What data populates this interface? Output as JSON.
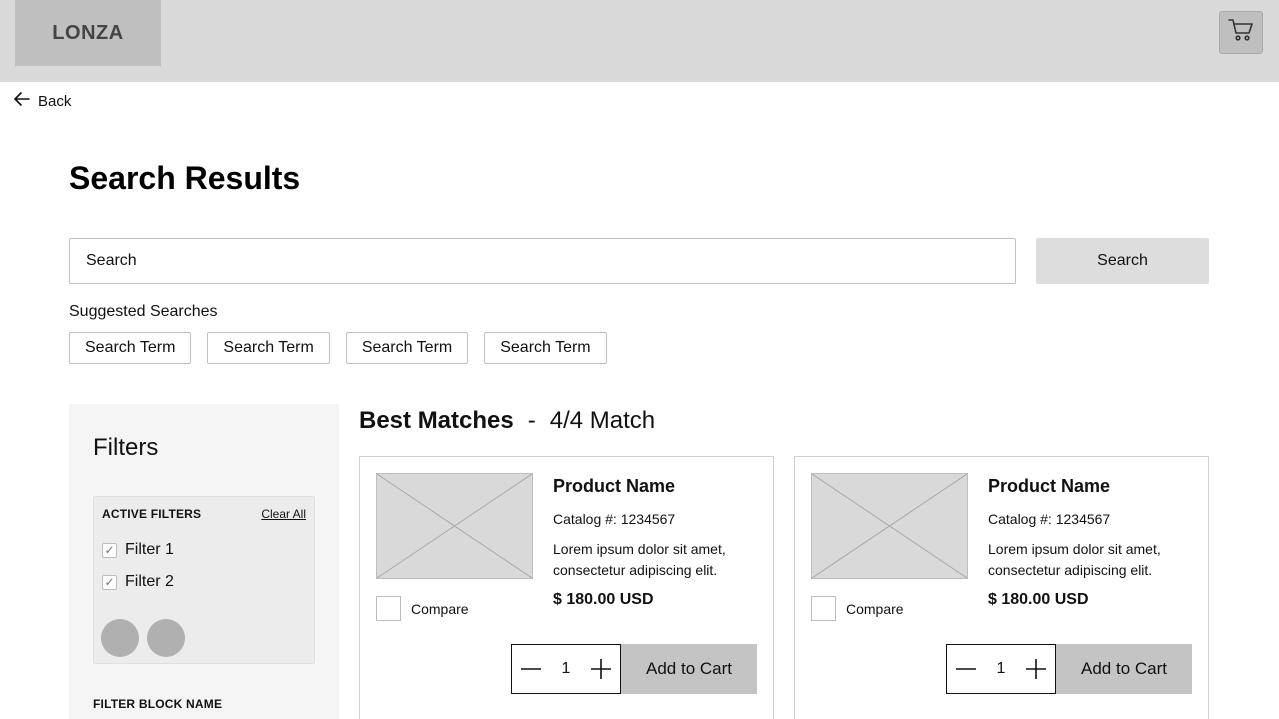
{
  "header": {
    "logo_text": "LONZA",
    "cart_icon": "cart-icon"
  },
  "nav": {
    "back_label": "Back",
    "back_icon": "arrow-left-icon"
  },
  "page": {
    "title": "Search Results"
  },
  "search": {
    "placeholder": "Search",
    "button_label": "Search"
  },
  "suggested": {
    "label": "Suggested Searches",
    "terms": [
      "Search Term",
      "Search Term",
      "Search Term",
      "Search Term"
    ]
  },
  "filters": {
    "title": "Filters",
    "active_label": "ACTIVE FILTERS",
    "clear_all_label": "Clear All",
    "active": [
      {
        "label": "Filter 1",
        "checked": true
      },
      {
        "label": "Filter 2",
        "checked": true
      }
    ],
    "block_name": "FILTER BLOCK NAME"
  },
  "results": {
    "heading": "Best Matches",
    "separator": "-",
    "match_text": "4/4 Match"
  },
  "products": [
    {
      "name": "Product Name",
      "catalog": "Catalog #: 1234567",
      "description": "Lorem ipsum dolor sit amet, consectetur adipiscing elit.",
      "price": "$ 180.00 USD",
      "compare_label": "Compare",
      "quantity": "1",
      "add_label": "Add to Cart"
    },
    {
      "name": "Product Name",
      "catalog": "Catalog #: 1234567",
      "description": "Lorem ipsum dolor sit amet, consectetur adipiscing elit.",
      "price": "$ 180.00 USD",
      "compare_label": "Compare",
      "quantity": "1",
      "add_label": "Add to Cart"
    }
  ],
  "colors": {
    "header_bg": "#d9d9d9",
    "logo_bg": "#bfbfbf",
    "filter_panel_bg": "#f5f5f5",
    "add_button_bg": "#c4c4c4"
  }
}
